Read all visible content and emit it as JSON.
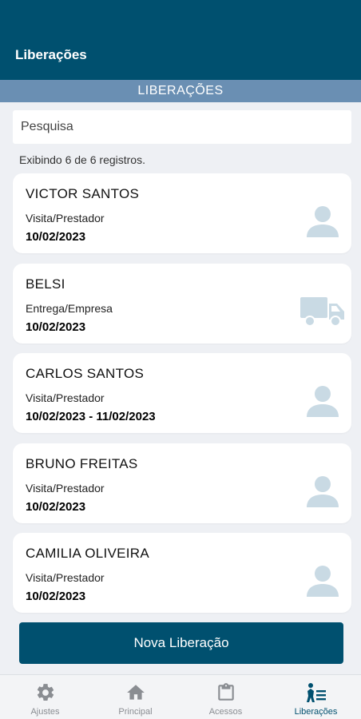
{
  "appbar": {
    "title": "Liberações"
  },
  "section": {
    "header": "LIBERAÇÕES"
  },
  "search": {
    "placeholder": "Pesquisa"
  },
  "records_info": "Exibindo 6 de 6 registros.",
  "releases": [
    {
      "name": "VICTOR SANTOS",
      "type": "Visita/Prestador",
      "date": "10/02/2023",
      "icon": "person-icon"
    },
    {
      "name": "BELSI",
      "type": "Entrega/Empresa",
      "date": "10/02/2023",
      "icon": "truck-icon"
    },
    {
      "name": "CARLOS SANTOS",
      "type": "Visita/Prestador",
      "date": "10/02/2023 - 11/02/2023",
      "icon": "person-icon"
    },
    {
      "name": "BRUNO FREITAS",
      "type": "Visita/Prestador",
      "date": "10/02/2023",
      "icon": "person-icon"
    },
    {
      "name": "CAMILIA OLIVEIRA",
      "type": "Visita/Prestador",
      "date": "10/02/2023",
      "icon": "person-icon"
    }
  ],
  "new_release_button": "Nova Liberação",
  "bottom_nav": [
    {
      "label": "Ajustes",
      "icon": "gear-icon"
    },
    {
      "label": "Principal",
      "icon": "home-icon"
    },
    {
      "label": "Acessos",
      "icon": "clipboard-icon"
    },
    {
      "label": "Liberações",
      "icon": "person-list-icon",
      "active": true
    }
  ],
  "colors": {
    "primary": "#00506f",
    "section_header": "#6a8fb3",
    "background": "#eef0f4",
    "icon_muted": "#c9dae4"
  }
}
